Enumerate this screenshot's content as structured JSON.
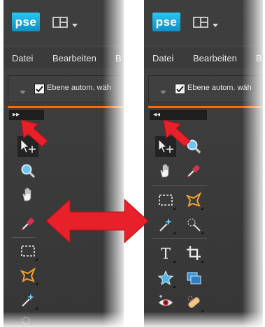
{
  "app": {
    "logo_text": "pse",
    "menu": [
      "Datei",
      "Bearbeiten",
      "B"
    ]
  },
  "options_bar": {
    "checkbox_checked": true,
    "checkbox_label": "Ebene autom. wäh"
  },
  "left_panel": {
    "toggle_glyph": "▸▸",
    "state": "collapsed",
    "tools": [
      "move",
      "zoom",
      "hand",
      "eyedropper",
      "rectangular-marquee",
      "lasso",
      "magic-wand",
      "quick-selection"
    ]
  },
  "right_panel": {
    "toggle_glyph": "◂◂",
    "state": "expanded",
    "tools": [
      "move",
      "zoom",
      "hand",
      "eyedropper",
      "rectangular-marquee",
      "lasso",
      "magic-wand",
      "quick-selection",
      "type",
      "crop",
      "custom-shape",
      "recompose",
      "red-eye",
      "spot-healing"
    ]
  },
  "colors": {
    "logo_bg": "#1aa9de",
    "accent_line": "#ff6a00",
    "panel_bg": "#3e3e3e",
    "annotation_arrow": "#e8202a"
  }
}
